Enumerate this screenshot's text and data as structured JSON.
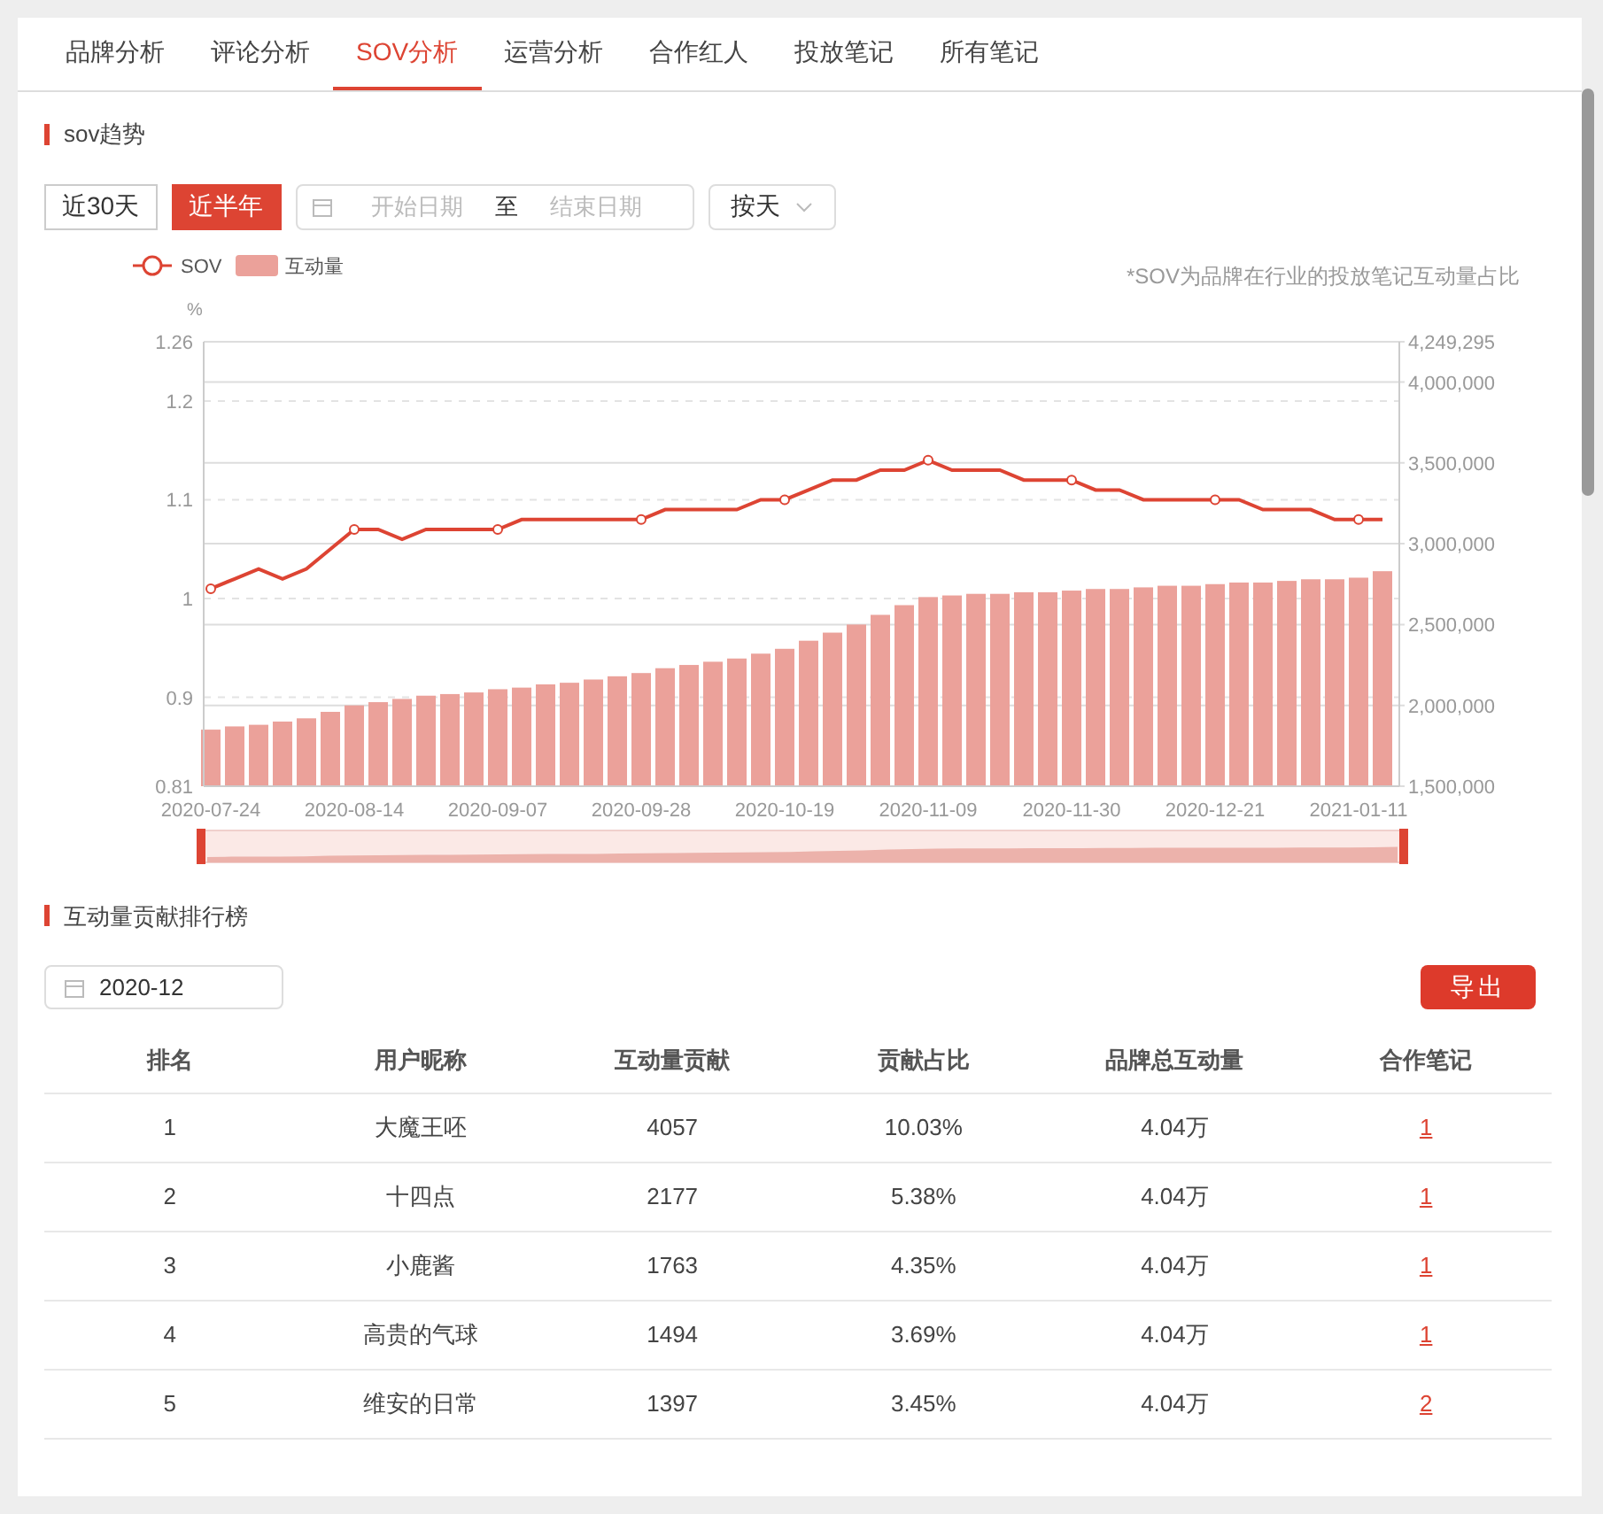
{
  "tabs": [
    {
      "label": "品牌分析",
      "selected": false
    },
    {
      "label": "评论分析",
      "selected": false
    },
    {
      "label": "SOV分析",
      "selected": true
    },
    {
      "label": "运营分析",
      "selected": false
    },
    {
      "label": "合作红人",
      "selected": false
    },
    {
      "label": "投放笔记",
      "selected": false
    },
    {
      "label": "所有笔记",
      "selected": false
    }
  ],
  "trend": {
    "title": "sov趋势",
    "ranges": [
      {
        "label": "近30天",
        "selected": false
      },
      {
        "label": "近半年",
        "selected": true
      }
    ],
    "date_range": {
      "start_placeholder": "开始日期",
      "separator": "至",
      "end_placeholder": "结束日期"
    },
    "granularity": "按天",
    "note": "*SOV为品牌在行业的投放笔记互动量占比",
    "chart_data": {
      "type": "bar",
      "ylabel": "%",
      "grid": true,
      "legend": "top-left",
      "categories": [
        "2020-07-24",
        null,
        null,
        null,
        null,
        null,
        "2020-08-14",
        null,
        null,
        null,
        null,
        null,
        "2020-09-07",
        null,
        null,
        null,
        null,
        null,
        "2020-09-28",
        null,
        null,
        null,
        null,
        null,
        "2020-10-19",
        null,
        null,
        null,
        null,
        null,
        "2020-11-09",
        null,
        null,
        null,
        null,
        null,
        "2020-11-30",
        null,
        null,
        null,
        null,
        null,
        "2020-12-21",
        null,
        null,
        null,
        null,
        null,
        "2021-01-11",
        null
      ],
      "ylim": [
        0.81,
        1.26
      ],
      "yticks": [
        {
          "value": 0.81,
          "label": "0.81"
        },
        {
          "value": 0.9,
          "label": "0.9"
        },
        {
          "value": 1,
          "label": "1"
        },
        {
          "value": 1.1,
          "label": "1.1"
        },
        {
          "value": 1.2,
          "label": "1.2"
        },
        {
          "value": 1.26,
          "label": "1.26"
        }
      ],
      "y2lim": [
        1500000,
        4249295
      ],
      "y2ticks": [
        {
          "value": 1500000,
          "label": "1,500,000"
        },
        {
          "value": 2000000,
          "label": "2,000,000"
        },
        {
          "value": 2500000,
          "label": "2,500,000"
        },
        {
          "value": 3000000,
          "label": "3,000,000"
        },
        {
          "value": 3500000,
          "label": "3,500,000"
        },
        {
          "value": 4000000,
          "label": "4,000,000"
        },
        {
          "value": 4249295,
          "label": "4,249,295"
        }
      ],
      "series": [
        {
          "name": "SOV",
          "type": "line",
          "color": "#dd4433",
          "values": [
            1.01,
            1.02,
            1.03,
            1.02,
            1.03,
            1.05,
            1.07,
            1.07,
            1.06,
            1.07,
            1.07,
            1.07,
            1.07,
            1.08,
            1.08,
            1.08,
            1.08,
            1.08,
            1.08,
            1.09,
            1.09,
            1.09,
            1.09,
            1.1,
            1.1,
            1.11,
            1.12,
            1.12,
            1.13,
            1.13,
            1.14,
            1.13,
            1.13,
            1.13,
            1.12,
            1.12,
            1.12,
            1.11,
            1.11,
            1.1,
            1.1,
            1.1,
            1.1,
            1.1,
            1.09,
            1.09,
            1.09,
            1.08,
            1.08,
            1.08
          ]
        },
        {
          "name": "互动量",
          "axis": "y2",
          "color": "#eba19a",
          "values": [
            1850000,
            1870000,
            1880000,
            1900000,
            1920000,
            1960000,
            2000000,
            2020000,
            2040000,
            2060000,
            2070000,
            2080000,
            2100000,
            2110000,
            2130000,
            2140000,
            2160000,
            2180000,
            2200000,
            2230000,
            2250000,
            2270000,
            2290000,
            2320000,
            2350000,
            2400000,
            2450000,
            2500000,
            2560000,
            2620000,
            2670000,
            2680000,
            2690000,
            2690000,
            2700000,
            2700000,
            2710000,
            2720000,
            2720000,
            2730000,
            2740000,
            2740000,
            2750000,
            2760000,
            2760000,
            2770000,
            2780000,
            2780000,
            2790000,
            2830000
          ]
        }
      ]
    }
  },
  "ranking": {
    "title": "互动量贡献排行榜",
    "month": "2020-12",
    "export": "导出",
    "columns": [
      "排名",
      "用户昵称",
      "互动量贡献",
      "贡献占比",
      "品牌总互动量",
      "合作笔记"
    ],
    "rows": [
      [
        "1",
        "大魔王呸",
        "4057",
        "10.03%",
        "4.04万",
        "1"
      ],
      [
        "2",
        "十四点",
        "2177",
        "5.38%",
        "4.04万",
        "1"
      ],
      [
        "3",
        "小鹿酱",
        "1763",
        "4.35%",
        "4.04万",
        "1"
      ],
      [
        "4",
        "高贵的气球",
        "1494",
        "3.69%",
        "4.04万",
        "1"
      ],
      [
        "5",
        "维安的日常",
        "1397",
        "3.45%",
        "4.04万",
        "2"
      ]
    ]
  }
}
